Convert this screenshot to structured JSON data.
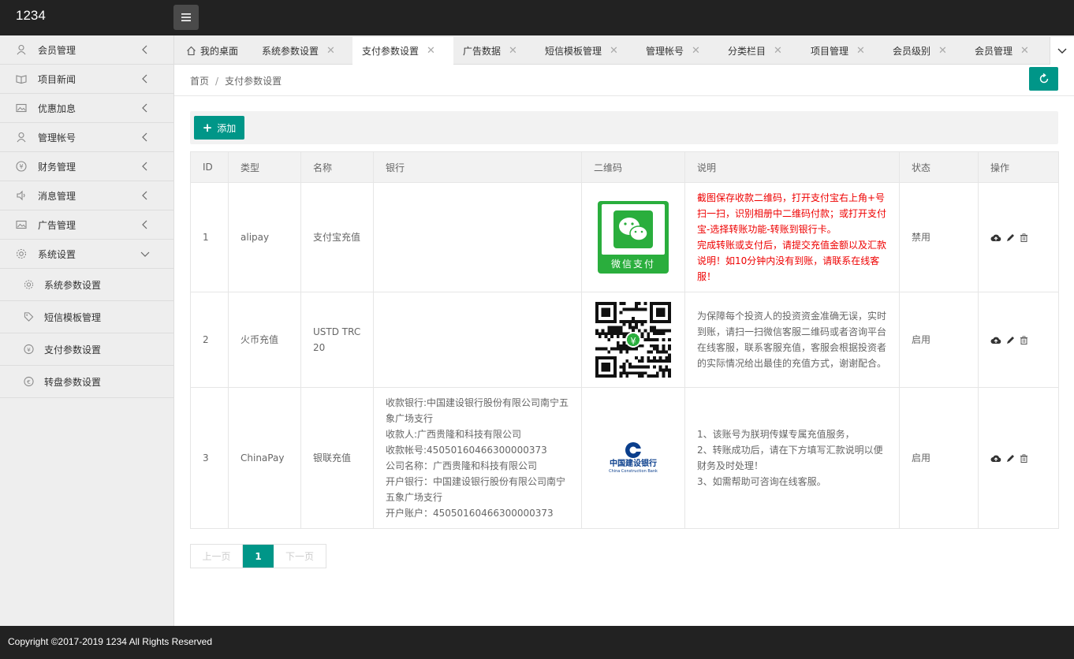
{
  "app": {
    "logo": "1234"
  },
  "sidebar": {
    "items": [
      {
        "label": "会员管理",
        "icon": "user-icon"
      },
      {
        "label": "项目新闻",
        "icon": "book-icon"
      },
      {
        "label": "优惠加息",
        "icon": "picture-icon"
      },
      {
        "label": "管理帐号",
        "icon": "user-icon"
      },
      {
        "label": "财务管理",
        "icon": "yen-icon"
      },
      {
        "label": "消息管理",
        "icon": "speaker-icon"
      },
      {
        "label": "广告管理",
        "icon": "picture-icon"
      },
      {
        "label": "系统设置",
        "icon": "gear-icon"
      }
    ],
    "subitems": [
      {
        "label": "系统参数设置",
        "icon": "gear-icon"
      },
      {
        "label": "短信模板管理",
        "icon": "tag-icon"
      },
      {
        "label": "支付参数设置",
        "icon": "yen-icon"
      },
      {
        "label": "转盘参数设置",
        "icon": "euro-icon"
      }
    ]
  },
  "tabs": [
    {
      "label": "我的桌面",
      "home": true
    },
    {
      "label": "系统参数设置"
    },
    {
      "label": "支付参数设置",
      "active": true
    },
    {
      "label": "广告数据"
    },
    {
      "label": "短信模板管理"
    },
    {
      "label": "管理帐号"
    },
    {
      "label": "分类栏目"
    },
    {
      "label": "项目管理"
    },
    {
      "label": "会员级别"
    },
    {
      "label": "会员管理"
    }
  ],
  "tab_close": "✕",
  "breadcrumb": {
    "home": "首页",
    "sep": "/",
    "current": "支付参数设置"
  },
  "toolbar": {
    "add_label": "添加",
    "add_icon": "+"
  },
  "table": {
    "headers": [
      "ID",
      "类型",
      "名称",
      "银行",
      "二维码",
      "说明",
      "状态",
      "操作"
    ],
    "rows": [
      {
        "id": "1",
        "type": "alipay",
        "name": "支付宝充值",
        "bank": [],
        "qr": "wechat-pay",
        "qr_text": "微信支付",
        "desc": [
          "截图保存收款二维码，打开支付宝右上角+号扫一扫，识别相册中二维码付款；或打开支付宝-选择转账功能-转账到银行卡。",
          "完成转账或支付后，请提交充值金额以及汇款说明！如10分钟内没有到账，请联系在线客服！"
        ],
        "desc_red": true,
        "status": "禁用"
      },
      {
        "id": "2",
        "type": "火币充值",
        "name": "USTD TRC 20",
        "bank": [],
        "qr": "qr-code",
        "desc": [
          "为保障每个投资人的投资资金准确无误，实时到账，请扫一扫微信客服二维码或者咨询平台在线客服，联系客服充值，客服会根据投资者的实际情况给出最佳的充值方式，谢谢配合。"
        ],
        "desc_red": false,
        "status": "启用"
      },
      {
        "id": "3",
        "type": "ChinaPay",
        "name": "银联充值",
        "bank": [
          "收款银行:中国建设银行股份有限公司南宁五象广场支行",
          "收款人:广西贵隆和科技有限公司",
          "收款帐号:45050160466300000373",
          "公司名称：广西贵隆和科技有限公司",
          "开户银行：中国建设银行股份有限公司南宁五象广场支行",
          "开户账户：45050160466300000373"
        ],
        "qr": "ccb-logo",
        "qr_text": "中国建设银行",
        "qr_subtext": "China Construction Bank",
        "desc": [
          "1、该账号为朕玥传媒专属充值服务，",
          "2、转账成功后，请在下方填写汇款说明以便财务及时处理！",
          "3、如需帮助可咨询在线客服。"
        ],
        "desc_red": false,
        "status": "启用"
      }
    ]
  },
  "pager": {
    "prev": "上一页",
    "current": "1",
    "next": "下一页"
  },
  "footer": {
    "copyright": "Copyright ©2017-2019 1234 All Rights Reserved"
  },
  "colors": {
    "accent": "#009688",
    "header": "#222222",
    "sidebar": "#eeeeee",
    "alert": "#ee0000"
  }
}
